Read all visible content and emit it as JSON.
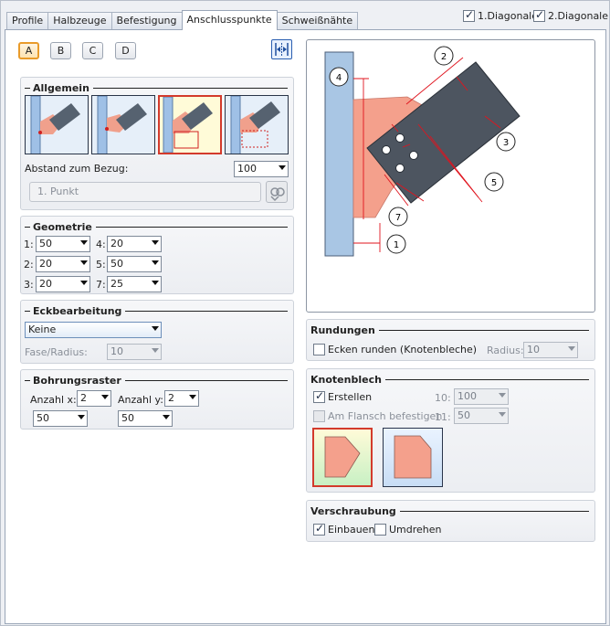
{
  "tabs": [
    "Profile",
    "Halbzeuge",
    "Befestigung",
    "Anschlusspunkte",
    "Schweißnähte"
  ],
  "active_tab": "Anschlusspunkte",
  "diagonals": [
    {
      "label": "1.Diagonale",
      "checked": true
    },
    {
      "label": "2.Diagonale",
      "checked": true
    }
  ],
  "variant_buttons": [
    "A",
    "B",
    "C",
    "D"
  ],
  "active_variant": "A",
  "allgemein": {
    "title": "Allgemein",
    "abstand_label": "Abstand zum Bezug:",
    "abstand_value": "100",
    "point_placeholder": "1. Punkt"
  },
  "geometrie": {
    "title": "Geometrie",
    "fields": [
      {
        "label": "1:",
        "value": "50"
      },
      {
        "label": "4:",
        "value": "20"
      },
      {
        "label": "2:",
        "value": "20"
      },
      {
        "label": "5:",
        "value": "50"
      },
      {
        "label": "3:",
        "value": "20"
      },
      {
        "label": "7:",
        "value": "25"
      }
    ]
  },
  "eckbearbeitung": {
    "title": "Eckbearbeitung",
    "mode": "Keine",
    "fase_label": "Fase/Radius:",
    "fase_value": "10"
  },
  "bohrungsraster": {
    "title": "Bohrungsraster",
    "anzahl_x_label": "Anzahl x:",
    "anzahl_x": "2",
    "anzahl_y_label": "Anzahl y:",
    "anzahl_y": "2",
    "spacing_x": "50",
    "spacing_y": "50"
  },
  "preview_labels": [
    "1",
    "2",
    "3",
    "4",
    "5",
    "7"
  ],
  "rundungen": {
    "title": "Rundungen",
    "ecken_label": "Ecken runden (Knotenbleche)",
    "ecken_checked": false,
    "radius_label": "Radius:",
    "radius_value": "10"
  },
  "knotenblech": {
    "title": "Knotenblech",
    "erstellen_label": "Erstellen",
    "erstellen_checked": true,
    "flansch_label": "Am Flansch befestigen",
    "flansch_checked": false,
    "field10_label": "10:",
    "field10_value": "100",
    "field11_label": "11:",
    "field11_value": "50"
  },
  "verschraubung": {
    "title": "Verschraubung",
    "einbauen_label": "Einbauen",
    "einbauen_checked": true,
    "umdrehen_label": "Umdrehen",
    "umdrehen_checked": false
  },
  "colors": {
    "plate": "#f4a08c",
    "column": "#a9c6e4",
    "beam": "#4d5560",
    "dimension": "#e0141e",
    "active_border": "#d33a2c",
    "variant_active": "#e99b2a"
  }
}
